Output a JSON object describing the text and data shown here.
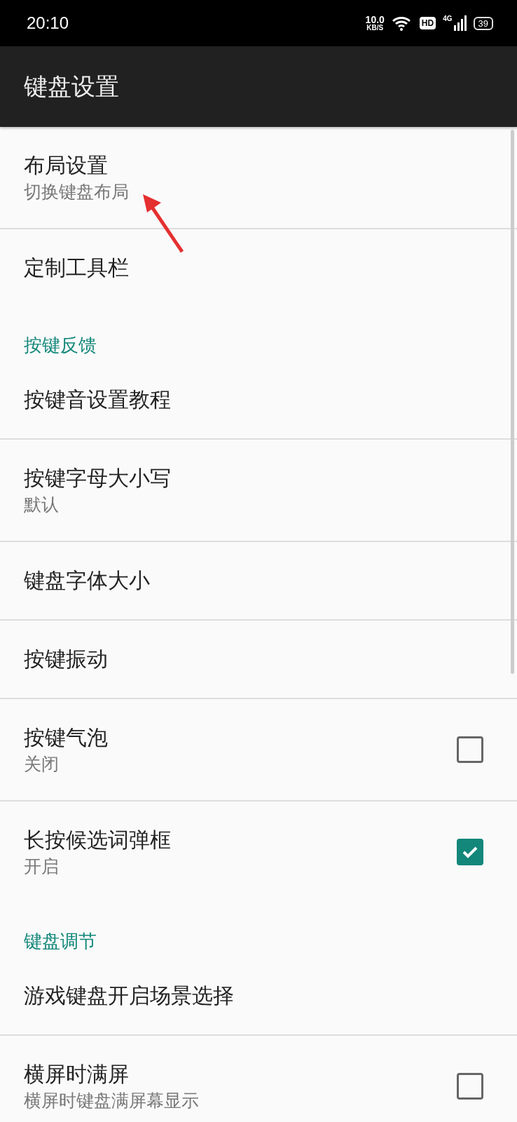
{
  "status_bar": {
    "time": "20:10",
    "speed": "10.0",
    "speed_unit": "KB/S",
    "hd": "HD",
    "network": "4G",
    "battery": "39"
  },
  "app_bar": {
    "title": "键盘设置"
  },
  "items": [
    {
      "kind": "item",
      "title": "布局设置",
      "summary": "切换键盘布局"
    },
    {
      "kind": "item",
      "title": "定制工具栏"
    },
    {
      "kind": "header",
      "title": "按键反馈"
    },
    {
      "kind": "item",
      "title": "按键音设置教程"
    },
    {
      "kind": "item",
      "title": "按键字母大小写",
      "summary": "默认"
    },
    {
      "kind": "item",
      "title": "键盘字体大小"
    },
    {
      "kind": "item",
      "title": "按键振动"
    },
    {
      "kind": "check",
      "title": "按键气泡",
      "summary": "关闭",
      "checked": false
    },
    {
      "kind": "check",
      "title": "长按候选词弹框",
      "summary": "开启",
      "checked": true
    },
    {
      "kind": "header",
      "title": "键盘调节"
    },
    {
      "kind": "item",
      "title": "游戏键盘开启场景选择"
    },
    {
      "kind": "check",
      "title": "横屏时满屏",
      "summary": "横屏时键盘满屏幕显示",
      "checked": false
    }
  ]
}
